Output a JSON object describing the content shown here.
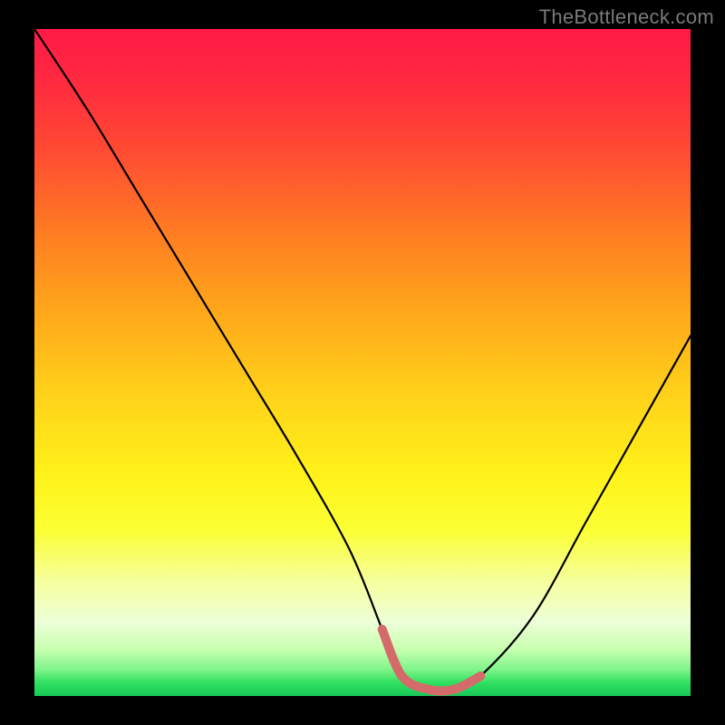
{
  "watermark": "TheBottleneck.com",
  "colors": {
    "page_bg": "#000000",
    "watermark": "#7a7a7a",
    "curve_main": "#000000",
    "curve_highlight": "#d46a6a",
    "gradient_stops": [
      "#ff1a47",
      "#ff2a3f",
      "#ff4a33",
      "#ff7a22",
      "#ffa61a",
      "#ffd21a",
      "#fff21a",
      "#fbff33",
      "#f6ffa0",
      "#ecffd8",
      "#c8ffb0",
      "#80f58a",
      "#30e060",
      "#18c858"
    ]
  },
  "chart_data": {
    "type": "line",
    "title": "",
    "xlabel": "",
    "ylabel": "",
    "xlim": [
      0,
      100
    ],
    "ylim": [
      0,
      100
    ],
    "grid": false,
    "series": [
      {
        "name": "bottleneck-curve",
        "x": [
          0,
          8,
          16,
          24,
          32,
          40,
          48,
          53,
          56,
          60,
          64,
          68,
          76,
          84,
          92,
          100
        ],
        "y": [
          100,
          88,
          75,
          62,
          49,
          36,
          22,
          10,
          3,
          1,
          1,
          3,
          12,
          26,
          40,
          54
        ]
      },
      {
        "name": "optimal-zone",
        "x": [
          53,
          56,
          60,
          64,
          68
        ],
        "y": [
          10,
          3,
          1,
          1,
          3
        ]
      }
    ],
    "annotations": []
  }
}
